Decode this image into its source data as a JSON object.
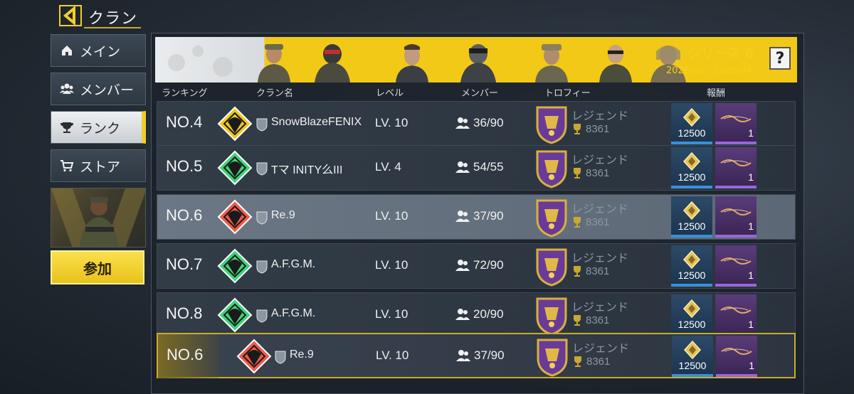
{
  "header": {
    "title": "クラン"
  },
  "nav": [
    {
      "label": "メイン",
      "icon": "home-icon"
    },
    {
      "label": "メンバー",
      "icon": "members-icon"
    },
    {
      "label": "ランク",
      "icon": "trophy-icon",
      "active": true
    },
    {
      "label": "ストア",
      "icon": "cart-icon"
    }
  ],
  "join_button": "参加",
  "banner": {
    "series": "シリーズ 6",
    "dates": "2026/02 - 2026/04",
    "help": "?"
  },
  "columns": {
    "rank": "ランキング",
    "name": "クラン名",
    "level": "レベル",
    "members": "メンバー",
    "trophy": "トロフィー",
    "reward": "報酬"
  },
  "rows": [
    {
      "rank": "NO.4",
      "name": "SnowBlazeFENIX",
      "level": "LV. 10",
      "members": "36/90",
      "tier": "レジェンド",
      "trophies": "8361",
      "reward_a": "12500",
      "reward_b": "1",
      "emblem_color": "#f0c81c"
    },
    {
      "rank": "NO.5",
      "name": "Tマ INITY么III",
      "level": "LV. 4",
      "members": "54/55",
      "tier": "レジェンド",
      "trophies": "8361",
      "reward_a": "12500",
      "reward_b": "1",
      "emblem_color": "#3ed47a"
    },
    {
      "rank": "NO.6",
      "name": "Re.9",
      "level": "LV. 10",
      "members": "37/90",
      "tier": "レジェンド",
      "trophies": "8361",
      "reward_a": "12500",
      "reward_b": "1",
      "emblem_color": "#ef5a48"
    },
    {
      "rank": "NO.7",
      "name": "A.F.G.M.",
      "level": "LV. 10",
      "members": "72/90",
      "tier": "レジェンド",
      "trophies": "8361",
      "reward_a": "12500",
      "reward_b": "1",
      "emblem_color": "#3ed47a"
    },
    {
      "rank": "NO.8",
      "name": "A.F.G.M.",
      "level": "LV. 10",
      "members": "20/90",
      "tier": "レジェンド",
      "trophies": "8361",
      "reward_a": "12500",
      "reward_b": "1",
      "emblem_color": "#3ed47a"
    }
  ],
  "my_row": {
    "rank": "NO.6",
    "name": "Re.9",
    "level": "LV. 10",
    "members": "37/90",
    "tier": "レジェンド",
    "trophies": "8361",
    "reward_a": "12500",
    "reward_b": "1",
    "emblem_color": "#ef5a48"
  },
  "colors": {
    "accent": "#f1cf2a",
    "reward_blue": "#3b8fd8",
    "reward_purple": "#9966d8"
  }
}
